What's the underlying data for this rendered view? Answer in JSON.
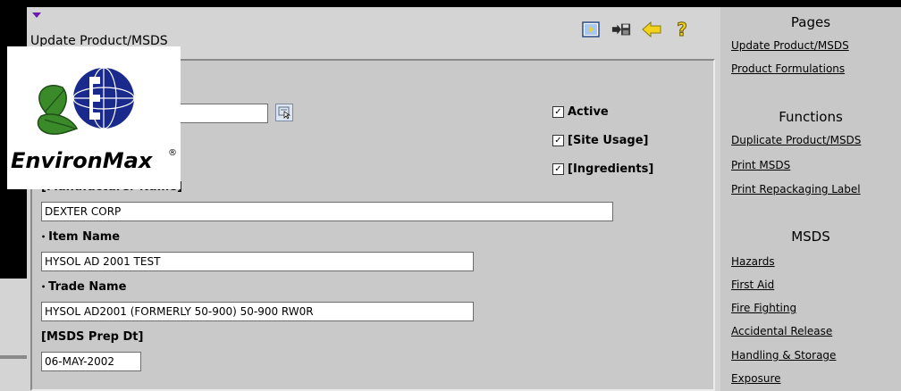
{
  "page": {
    "title": "Update Product/MSDS"
  },
  "logo": {
    "brand": "EnvironMax",
    "mark": "®"
  },
  "form": {
    "manufacturer_label": "[Manufacturer Name]",
    "manufacturer_value": "DEXTER CORP",
    "item_name_label": "Item Name",
    "item_name_value": "HYSOL AD 2001 TEST",
    "trade_name_label": "Trade Name",
    "trade_name_value": "HYSOL AD2001 (FORMERLY 50-900) 50-900 RW0R",
    "prep_dt_label": "[MSDS Prep Dt]",
    "prep_dt_value": "06-MAY-2002",
    "required_marker": "•",
    "checkboxes": [
      {
        "label": "Active",
        "checked": true
      },
      {
        "label": "[Site Usage]",
        "checked": true
      },
      {
        "label": "[Ingredients]",
        "checked": true
      }
    ],
    "check_glyph": "☑"
  },
  "toolbar": {
    "icons": [
      "record-icon",
      "save-exit-icon",
      "back-arrow-icon",
      "help-icon"
    ],
    "help_glyph": "?"
  },
  "sidebar": {
    "pages_heading": "Pages",
    "pages": [
      "Update Product/MSDS",
      "Product Formulations"
    ],
    "functions_heading": "Functions",
    "functions": [
      "Duplicate Product/MSDS",
      "Print MSDS",
      "Print Repackaging Label"
    ],
    "msds_heading": "MSDS",
    "msds": [
      "Hazards",
      "First Aid",
      "Fire Fighting",
      "Accidental Release",
      "Handling & Storage",
      "Exposure"
    ]
  },
  "colors": {
    "accent": "#6a1bb0",
    "logo_blue": "#1a2a8c",
    "logo_green": "#3a8a2a",
    "toolbar_yellow": "#f2d21a"
  }
}
